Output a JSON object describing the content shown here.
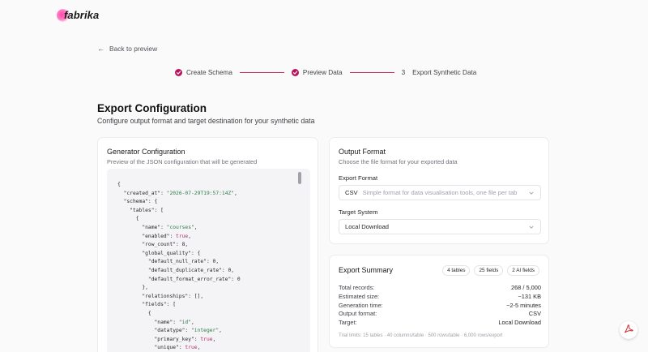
{
  "brand": {
    "name": "fabrika",
    "accent": "#b9155f"
  },
  "nav": {
    "back_label": "Back to preview"
  },
  "stepper": {
    "steps": [
      {
        "label": "Create Schema",
        "status": "complete"
      },
      {
        "label": "Preview Data",
        "status": "complete"
      },
      {
        "number": "3",
        "label": "Export Synthetic Data",
        "status": "current"
      }
    ]
  },
  "page": {
    "title": "Export Configuration",
    "subtitle": "Configure output format and target destination for your synthetic data"
  },
  "generator": {
    "title": "Generator Configuration",
    "description": "Preview of the JSON configuration that will be generated",
    "json_lines": [
      "{",
      "  \"created_at\": \"2026-07-29T19:57:14Z\",",
      "  \"schema\": {",
      "    \"tables\": [",
      "      {",
      "        \"name\": \"courses\",",
      "        \"enabled\": true,",
      "        \"row_count\": 8,",
      "        \"global_quality\": {",
      "          \"default_null_rate\": 0,",
      "          \"default_duplicate_rate\": 0,",
      "          \"default_format_error_rate\": 0",
      "        },",
      "        \"relationships\": [],",
      "        \"fields\": [",
      "          {",
      "            \"name\": \"id\",",
      "            \"datatype\": \"integer\",",
      "            \"primary_key\": true,",
      "            \"unique\": true,"
    ]
  },
  "output_format": {
    "title": "Output Format",
    "description": "Choose the file format for your exported data",
    "format_label": "Export Format",
    "format_value": "CSV",
    "format_hint": "Simple format for data visualisation tools, one file per tab",
    "target_label": "Target System",
    "target_value": "Local Download"
  },
  "summary": {
    "title": "Export Summary",
    "badges": [
      "4 tables",
      "25 fields",
      "2 AI fields"
    ],
    "rows": [
      {
        "label": "Total records:",
        "value": "268 / 5,000"
      },
      {
        "label": "Estimated size:",
        "value": "~131 KB"
      },
      {
        "label": "Generation time:",
        "value": "~2-5 minutes"
      },
      {
        "label": "Output format:",
        "value": "CSV"
      },
      {
        "label": "Target:",
        "value": "Local Download"
      }
    ],
    "limits": "Trial limits: 15 tables · 40 columns/table · 500 rows/table · 6,000 rows/export"
  },
  "icons": {
    "back": "arrow-left-icon",
    "check": "check-circle-icon",
    "chevron": "chevron-down-icon",
    "pdf": "acrobat-pdf-icon"
  }
}
